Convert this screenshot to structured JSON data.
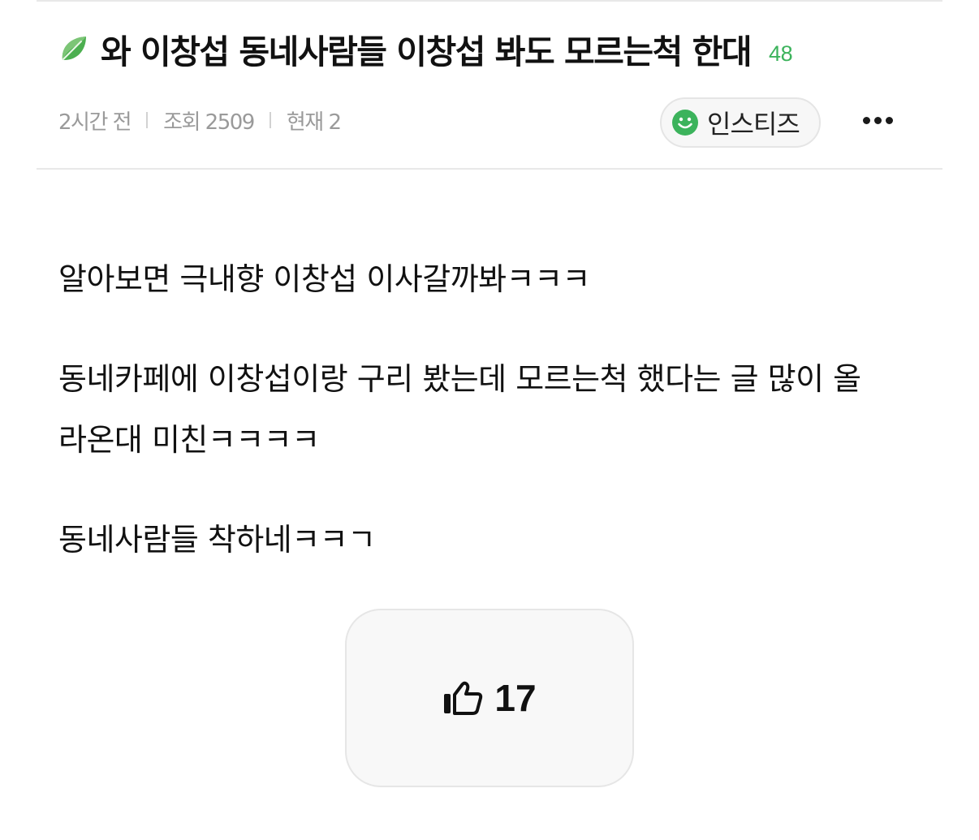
{
  "post": {
    "title": "와 이창섭 동네사람들 이창섭 봐도 모르는척 한대",
    "comment_count": "48",
    "title_icon": "leaf-icon",
    "meta": {
      "time": "2시간 전",
      "views": "조회 2509",
      "current": "현재 2"
    },
    "board": {
      "label": "인스티즈",
      "icon": "smile-icon"
    },
    "more_icon": "more-icon",
    "body": [
      "알아보면 극내향 이창섭 이사갈까봐ㅋㅋㅋ",
      "동네카페에 이창섭이랑 구리 봤는데 모르는척 했다는 글 많이 올",
      "라온대 미친ㅋㅋㅋㅋ",
      "동네사람들 착하네ㅋㅋㄱ"
    ],
    "like": {
      "count": "17",
      "icon": "thumbs-up-icon"
    }
  },
  "colors": {
    "accent_green": "#3cb35c",
    "meta_gray": "#9a9a9a",
    "divider": "#e8e8e8"
  }
}
